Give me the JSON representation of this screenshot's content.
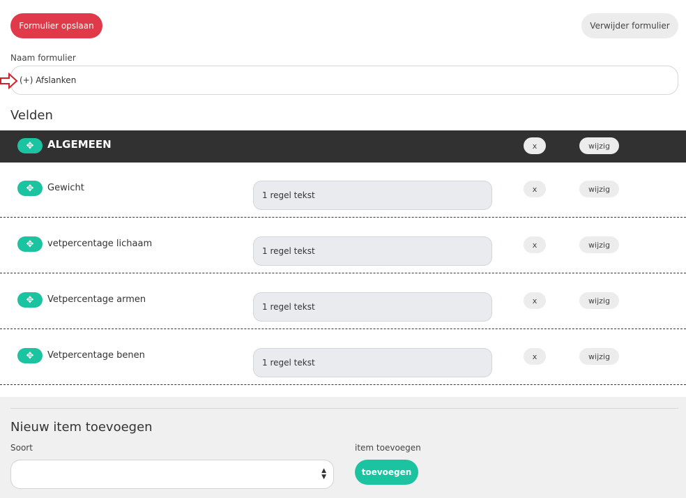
{
  "toolbar": {
    "save_label": "Formulier opslaan",
    "delete_label": "Verwijder formulier"
  },
  "form": {
    "name_label": "Naam formulier",
    "name_value": "(+) Afslanken"
  },
  "fields": {
    "section_title": "Velden",
    "group": {
      "title": "ALGEMEEN",
      "remove_label": "x",
      "edit_label": "wijzig"
    },
    "items": [
      {
        "label": "Gewicht",
        "type": "1 regel tekst",
        "remove_label": "x",
        "edit_label": "wijzig"
      },
      {
        "label": "vetpercentage lichaam",
        "type": "1 regel tekst",
        "remove_label": "x",
        "edit_label": "wijzig"
      },
      {
        "label": "Vetpercentage armen",
        "type": "1 regel tekst",
        "remove_label": "x",
        "edit_label": "wijzig"
      },
      {
        "label": "Vetpercentage benen",
        "type": "1 regel tekst",
        "remove_label": "x",
        "edit_label": "wijzig"
      }
    ]
  },
  "new_item": {
    "title": "Nieuw item toevoegen",
    "type_label": "Soort",
    "type_value": "",
    "add_label": "item toevoegen",
    "add_button": "toevoegen"
  },
  "icons": {
    "drag": "move-icon",
    "annotation": "arrow-right-icon",
    "select": "sort-arrows-icon"
  },
  "colors": {
    "primary_red": "#e03a4a",
    "accent_teal": "#1cc3a0",
    "header_dark": "#313131"
  }
}
